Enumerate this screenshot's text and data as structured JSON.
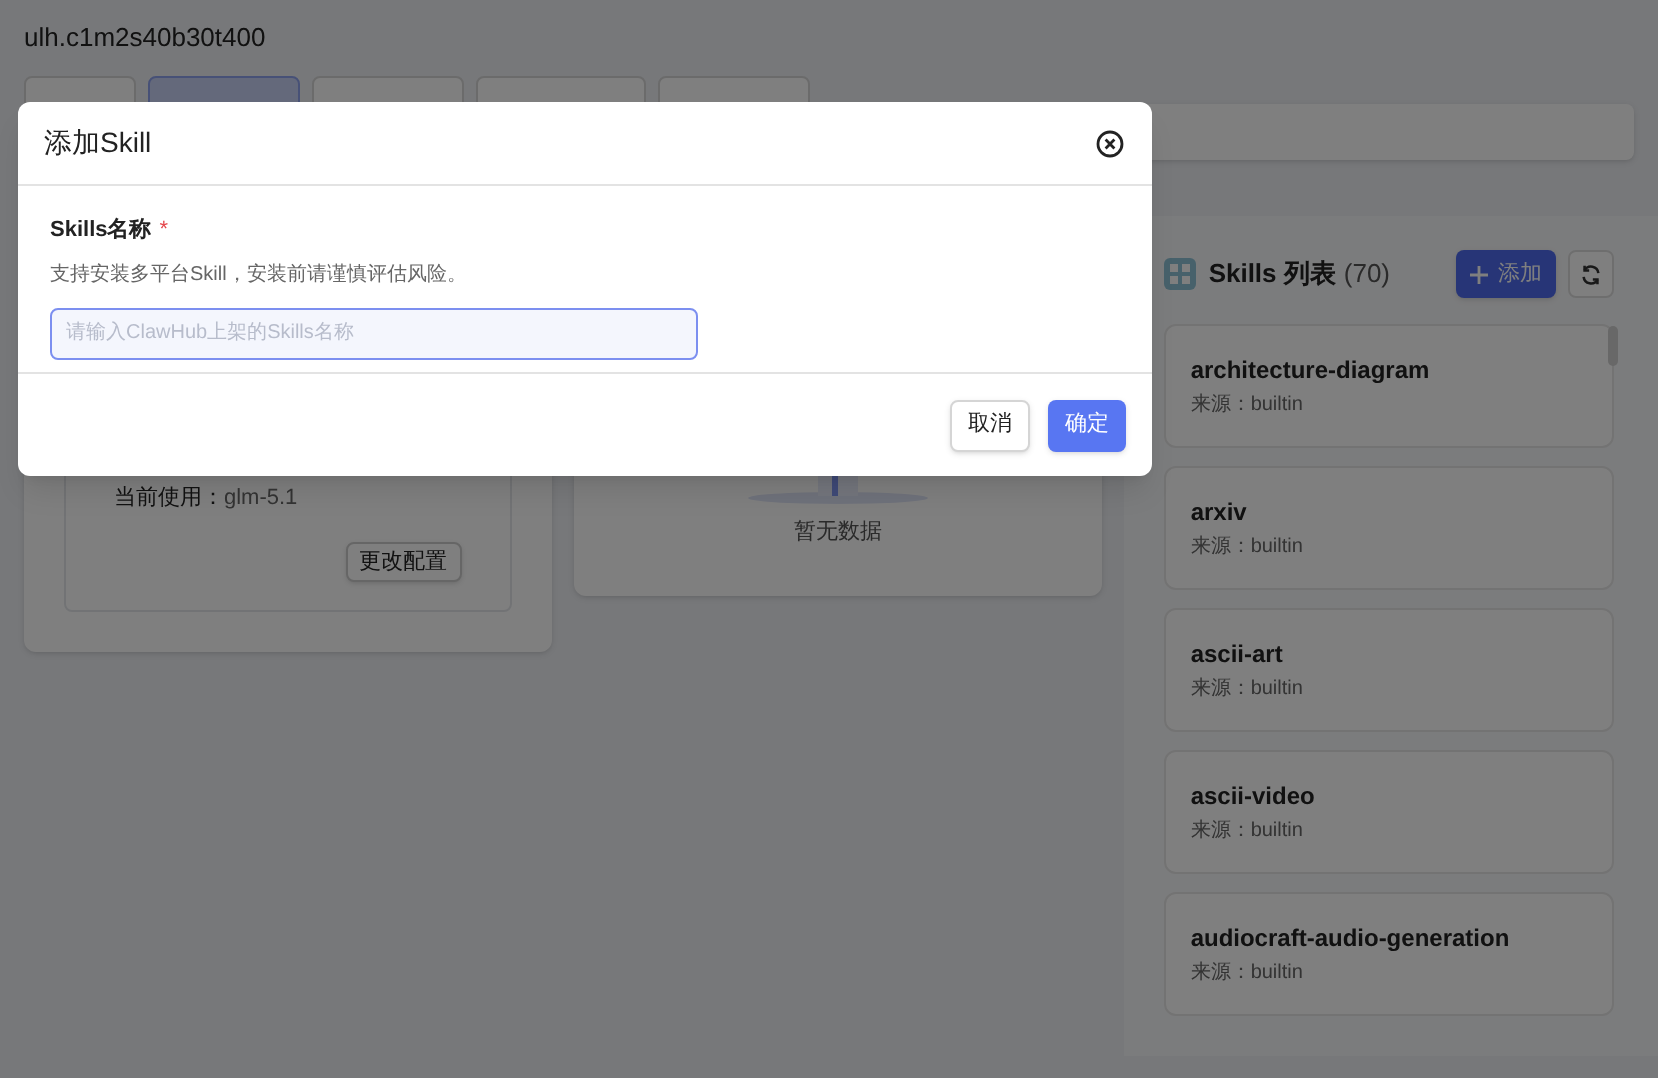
{
  "page": {
    "title": "ulh.c1m2s40b30t400",
    "tabs": [
      {
        "selected": false
      },
      {
        "selected": true
      },
      {
        "selected": false
      },
      {
        "selected": false
      },
      {
        "selected": false
      }
    ]
  },
  "model_card": {
    "current_label": "当前使用：",
    "current_value": "glm-5.1",
    "change_button": "更改配置"
  },
  "empty_card": {
    "empty_text": "暂无数据"
  },
  "skills_panel": {
    "title": "Skills 列表",
    "count": "(70)",
    "add_button": "添加",
    "items": [
      {
        "name": "architecture-diagram",
        "source": "来源：builtin"
      },
      {
        "name": "arxiv",
        "source": "来源：builtin"
      },
      {
        "name": "ascii-art",
        "source": "来源：builtin"
      },
      {
        "name": "ascii-video",
        "source": "来源：builtin"
      },
      {
        "name": "audiocraft-audio-generation",
        "source": "来源：builtin"
      }
    ]
  },
  "dialog": {
    "title": "添加Skill",
    "field_label": "Skills名称",
    "required_mark": "*",
    "hint": "支持安装多平台Skill，安装前请谨慎评估风险。",
    "placeholder": "请输入ClawHub上架的Skills名称",
    "cancel_button": "取消",
    "confirm_button": "确定"
  }
}
